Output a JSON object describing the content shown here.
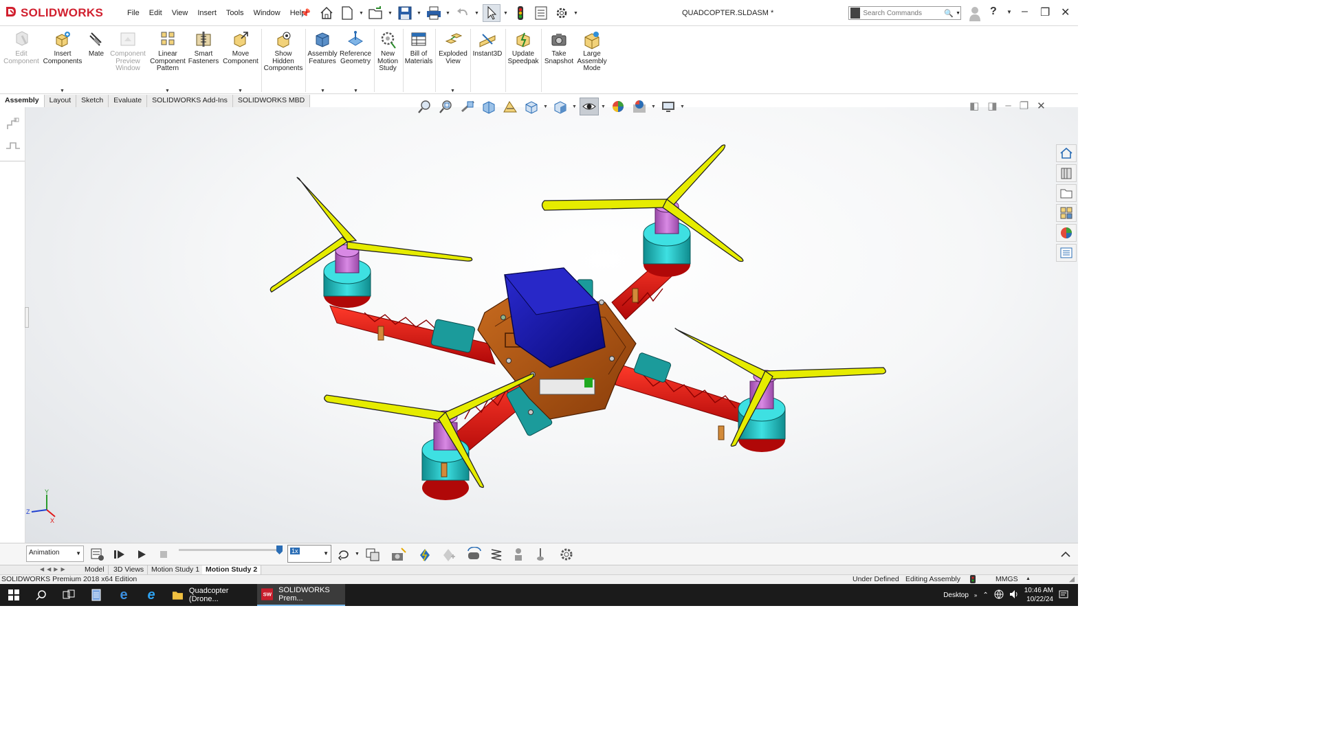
{
  "app": {
    "logo_text": "SOLIDWORKS",
    "document_title": "QUADCOPTER.SLDASM *",
    "menu": [
      "File",
      "Edit",
      "View",
      "Insert",
      "Tools",
      "Window",
      "Help"
    ],
    "search_placeholder": "Search Commands"
  },
  "command_manager": {
    "commands": [
      {
        "label": "Edit Component",
        "icon": "edit-component-icon",
        "enabled": false
      },
      {
        "label": "Insert Components",
        "icon": "insert-components-icon",
        "enabled": true
      },
      {
        "label": "Mate",
        "icon": "mate-icon",
        "enabled": true
      },
      {
        "label": "Component Preview Window",
        "icon": "component-preview-icon",
        "enabled": false
      },
      {
        "label": "Linear Component Pattern",
        "icon": "linear-pattern-icon",
        "enabled": true
      },
      {
        "label": "Smart Fasteners",
        "icon": "smart-fasteners-icon",
        "enabled": true
      },
      {
        "label": "Move Component",
        "icon": "move-component-icon",
        "enabled": true
      },
      {
        "label": "Show Hidden Components",
        "icon": "show-hidden-icon",
        "enabled": true
      },
      {
        "label": "Assembly Features",
        "icon": "assembly-features-icon",
        "enabled": true
      },
      {
        "label": "Reference Geometry",
        "icon": "reference-geometry-icon",
        "enabled": true
      },
      {
        "label": "New Motion Study",
        "icon": "motion-study-icon",
        "enabled": true
      },
      {
        "label": "Bill of Materials",
        "icon": "bill-of-materials-icon",
        "enabled": true
      },
      {
        "label": "Exploded View",
        "icon": "exploded-view-icon",
        "enabled": true
      },
      {
        "label": "Instant3D",
        "icon": "instant3d-icon",
        "enabled": true
      },
      {
        "label": "Update Speedpak",
        "icon": "speedpak-icon",
        "enabled": true
      },
      {
        "label": "Take Snapshot",
        "icon": "snapshot-icon",
        "enabled": true
      },
      {
        "label": "Large Assembly Mode",
        "icon": "large-assembly-icon",
        "enabled": true
      }
    ],
    "tabs": [
      "Assembly",
      "Layout",
      "Sketch",
      "Evaluate",
      "SOLIDWORKS Add-Ins",
      "SOLIDWORKS MBD"
    ],
    "active_tab": "Assembly"
  },
  "motion_manager": {
    "study_type": "Animation",
    "playback_speed": "1x",
    "tabs": [
      "Model",
      "3D Views",
      "Motion Study 1",
      "Motion Study 2"
    ],
    "active_tab": "Motion Study 2"
  },
  "status_bar": {
    "product": "SOLIDWORKS Premium 2018 x64 Edition",
    "definition": "Under Defined",
    "mode": "Editing Assembly",
    "units": "MMGS"
  },
  "triad": {
    "x": "X",
    "y": "Y",
    "z": "Z"
  },
  "taskbar": {
    "apps": [
      {
        "label": "Quadcopter (Drone...",
        "active": false
      },
      {
        "label": "SOLIDWORKS Prem...",
        "active": true
      }
    ],
    "desktop_label": "Desktop",
    "time": "10:46 AM",
    "date": "10/22/24"
  },
  "colors": {
    "frame": "#e81010",
    "plate": "#b5520d",
    "battery": "#1414b4",
    "motor": "#1ec2c4",
    "hub": "#c874d6",
    "propeller": "#e6ec00",
    "esc": "#1b9b9b",
    "brand": "#d1202f"
  }
}
